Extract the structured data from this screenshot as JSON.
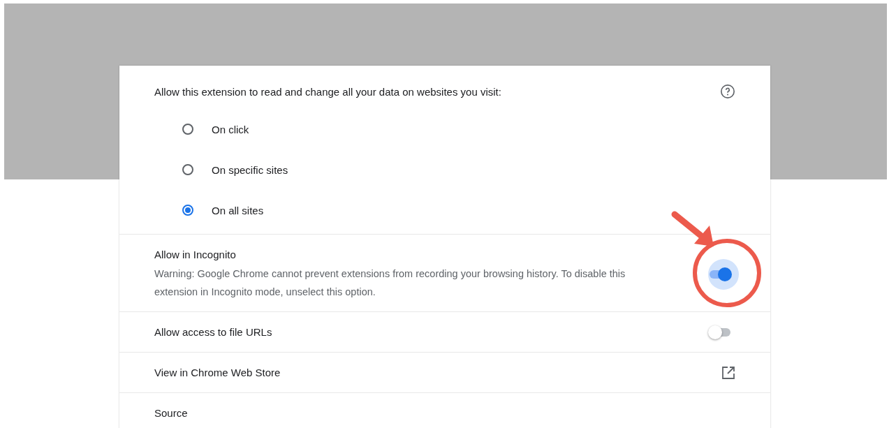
{
  "site_access": {
    "prompt": "Allow this extension to read and change all your data on websites you visit:",
    "options": [
      {
        "label": "On click",
        "selected": false
      },
      {
        "label": "On specific sites",
        "selected": false
      },
      {
        "label": "On all sites",
        "selected": true
      }
    ]
  },
  "rows": [
    {
      "kind": "toggle",
      "label": "Allow in Incognito",
      "description": "Warning: Google Chrome cannot prevent extensions from recording your browsing history. To disable this extension in Incognito mode, unselect this option.",
      "on": true,
      "highlighted": true
    },
    {
      "kind": "toggle",
      "label": "Allow access to file URLs",
      "on": false,
      "highlighted": false
    },
    {
      "kind": "link",
      "label": "View in Chrome Web Store"
    },
    {
      "kind": "plain",
      "label": "Source"
    }
  ]
}
